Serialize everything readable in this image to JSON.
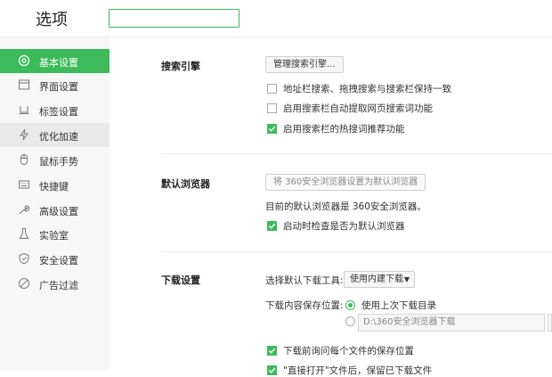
{
  "header": {
    "title": "选项",
    "search": {
      "value": "",
      "placeholder": ""
    }
  },
  "sidebar": {
    "items": [
      {
        "label": "基本设置",
        "icon": "gear-icon"
      },
      {
        "label": "界面设置",
        "icon": "window-icon"
      },
      {
        "label": "标签设置",
        "icon": "tab-icon"
      },
      {
        "label": "优化加速",
        "icon": "lightning-icon"
      },
      {
        "label": "鼠标手势",
        "icon": "mouse-icon"
      },
      {
        "label": "快捷键",
        "icon": "keyboard-icon"
      },
      {
        "label": "高级设置",
        "icon": "wrench-icon"
      },
      {
        "label": "实验室",
        "icon": "flask-icon"
      },
      {
        "label": "安全设置",
        "icon": "shield-icon"
      },
      {
        "label": "广告过滤",
        "icon": "block-icon"
      }
    ]
  },
  "search_engine": {
    "title": "搜索引擎",
    "manage_button": "管理搜索引擎...",
    "options": [
      {
        "label": "地址栏搜索、拖拽搜索与搜索栏保持一致",
        "checked": false
      },
      {
        "label": "启用搜索栏自动提取网页搜索词功能",
        "checked": false
      },
      {
        "label": "启用搜索栏的热搜词推荐功能",
        "checked": true
      }
    ]
  },
  "default_browser": {
    "title": "默认浏览器",
    "set_button": "将 360安全浏览器设置为默认浏览器",
    "status_text": "目前的默认浏览器是 360安全浏览器。",
    "check_option": {
      "label": "启动时检查是否为默认浏览器",
      "checked": true
    }
  },
  "download": {
    "title": "下载设置",
    "tool_label": "选择默认下载工具:",
    "tool_value": "使用内建下载",
    "location_label": "下载内容保存位置:",
    "last_dir_option": "使用上次下载目录",
    "custom_path": "D:\\360安全浏览器下载",
    "ask_option": {
      "label": "下载前询问每个文件的保存位置",
      "checked": true
    },
    "open_option": {
      "label": "\"直接打开\"文件后，保留已下载文件",
      "checked": true
    }
  },
  "colors": {
    "accent": "#3dbb5b"
  }
}
